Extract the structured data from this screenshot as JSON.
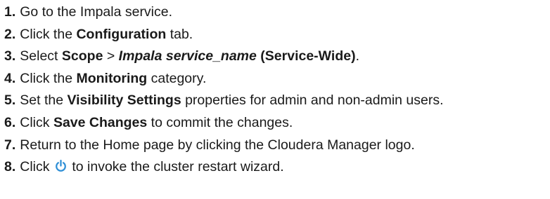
{
  "steps": [
    {
      "num": "1.",
      "parts": [
        {
          "text": "Go to the Impala service."
        }
      ]
    },
    {
      "num": "2.",
      "parts": [
        {
          "text": "Click the "
        },
        {
          "text": "Configuration"
        },
        {
          "text": " tab."
        }
      ]
    },
    {
      "num": "3.",
      "parts": [
        {
          "text": "Select "
        },
        {
          "text": "Scope"
        },
        {
          "text": " > "
        },
        {
          "text": "Impala service_name"
        },
        {
          "text": " (Service-Wide)"
        },
        {
          "text": "."
        }
      ]
    },
    {
      "num": "4.",
      "parts": [
        {
          "text": "Click the "
        },
        {
          "text": "Monitoring"
        },
        {
          "text": " category."
        }
      ]
    },
    {
      "num": "5.",
      "parts": [
        {
          "text": "Set the "
        },
        {
          "text": "Visibility Settings"
        },
        {
          "text": " properties for admin and non-admin users."
        }
      ]
    },
    {
      "num": "6.",
      "parts": [
        {
          "text": "Click "
        },
        {
          "text": "Save Changes"
        },
        {
          "text": " to commit the changes."
        }
      ]
    },
    {
      "num": "7.",
      "parts": [
        {
          "text": "Return to the Home page by clicking the Cloudera Manager logo."
        }
      ]
    },
    {
      "num": "8.",
      "parts": [
        {
          "text": "Click "
        },
        {
          "text": " to invoke the cluster restart wizard."
        }
      ]
    }
  ],
  "icons": {
    "restart": {
      "name": "restart-power-icon",
      "color": "#2f8fd6"
    }
  }
}
